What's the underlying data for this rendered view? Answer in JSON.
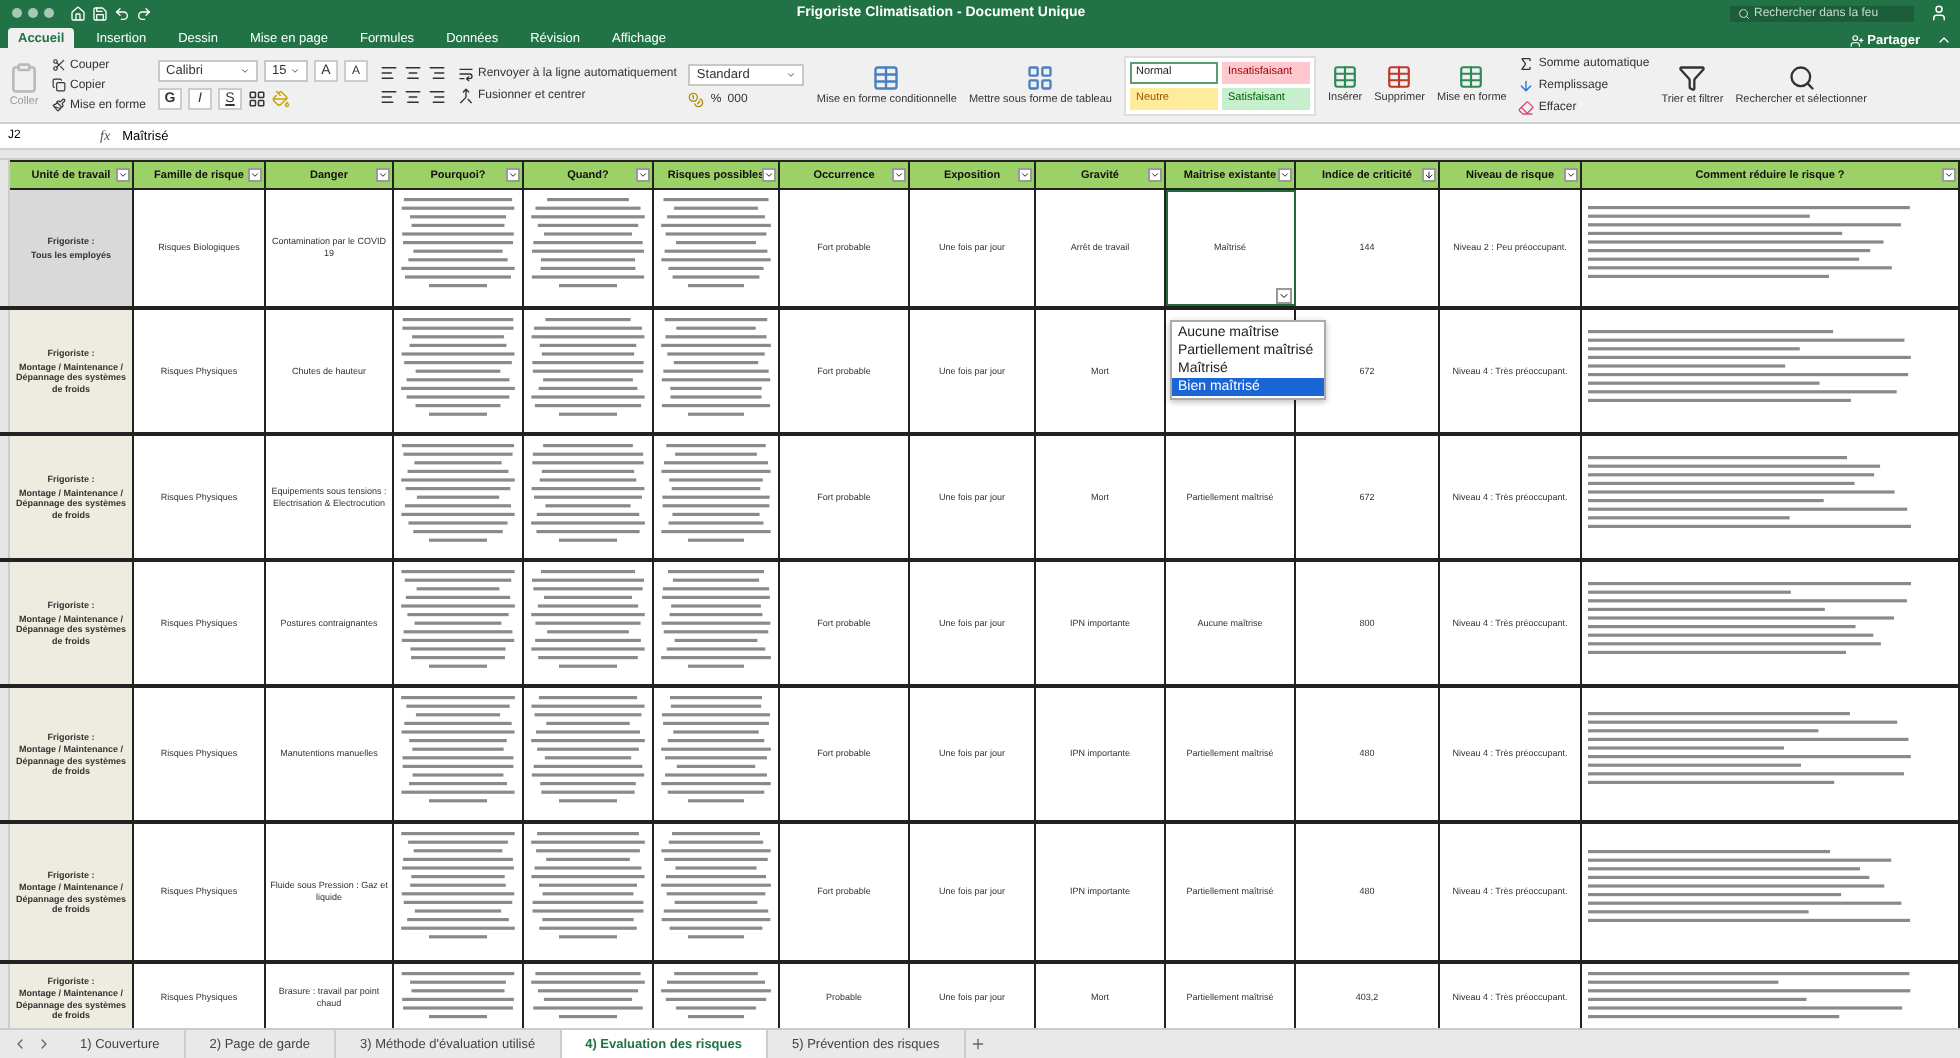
{
  "window": {
    "title": "Frigoriste Climatisation - Document Unique",
    "search_placeholder": "Rechercher dans la feu",
    "share": "Partager"
  },
  "ribbon_tabs": [
    {
      "label": "Accueil",
      "selected": true
    },
    {
      "label": "Insertion",
      "selected": false
    },
    {
      "label": "Dessin",
      "selected": false
    },
    {
      "label": "Mise en page",
      "selected": false
    },
    {
      "label": "Formules",
      "selected": false
    },
    {
      "label": "Données",
      "selected": false
    },
    {
      "label": "Révision",
      "selected": false
    },
    {
      "label": "Affichage",
      "selected": false
    }
  ],
  "ribbon": {
    "paste": "Coller",
    "cut": "Couper",
    "copy": "Copier",
    "format_painter": "Mise en forme",
    "font_name": "Calibri",
    "font_size": "15",
    "grow": "A",
    "shrink": "A",
    "bold": "G",
    "italic": "I",
    "underline": "S",
    "wrap": "Renvoyer à la ligne automatiquement",
    "merge": "Fusionner et centrer",
    "number_format": "Standard",
    "percent": "%",
    "thousands": "000",
    "conditional": "Mise en forme conditionnelle",
    "as_table": "Mettre sous forme de tableau",
    "styles": [
      {
        "label": "Normal",
        "kind": "normal"
      },
      {
        "label": "Insatisfaisant",
        "kind": "bad"
      },
      {
        "label": "Neutre",
        "kind": "neutral"
      },
      {
        "label": "Satisfaisant",
        "kind": "good"
      }
    ],
    "cells": [
      "Insérer",
      "Supprimer",
      "Mise en forme"
    ],
    "editing": [
      "Somme automatique",
      "Remplissage",
      "Effacer"
    ],
    "sort": "Trier et filtrer",
    "find": "Rechercher et sélectionner"
  },
  "formula_bar": {
    "cell": "J2",
    "fx": "fx",
    "value": "Maîtrisé"
  },
  "table": {
    "columns": [
      {
        "label": "Unité de travail",
        "sorted": false
      },
      {
        "label": "Famille de risque",
        "sorted": false
      },
      {
        "label": "Danger",
        "sorted": false
      },
      {
        "label": "Pourquoi?",
        "sorted": false
      },
      {
        "label": "Quand?",
        "sorted": false
      },
      {
        "label": "Risques possibles",
        "sorted": false
      },
      {
        "label": "Occurrence",
        "sorted": false
      },
      {
        "label": "Exposition",
        "sorted": false
      },
      {
        "label": "Gravité",
        "sorted": false
      },
      {
        "label": "Maitrise existante",
        "sorted": false
      },
      {
        "label": "Indice de criticité",
        "sorted": true
      },
      {
        "label": "Niveau de risque",
        "sorted": false
      },
      {
        "label": "Comment réduire le risque ?",
        "sorted": false
      }
    ],
    "rows": [
      {
        "unit_title": "Frigoriste :",
        "unit_detail": "Tous les employés",
        "shaded": true,
        "selected": true,
        "family": "Risques Biologiques",
        "danger": "Contamination par le COVID 19",
        "occurrence": "Fort probable",
        "exposure": "Une fois par jour",
        "severity": "Arrêt de travail",
        "control": "Maîtrisé",
        "criticality": "144",
        "level": "Niveau 2 : Peu préoccupant."
      },
      {
        "unit_title": "Frigoriste :",
        "unit_detail": "Montage / Maintenance / Dépannage des systèmes de froids",
        "shaded": false,
        "selected": false,
        "family": "Risques Physiques",
        "danger": "Chutes de hauteur",
        "occurrence": "Fort probable",
        "exposure": "Une fois par jour",
        "severity": "Mort",
        "criticality": "672",
        "level": "Niveau 4 : Très préoccupant."
      },
      {
        "unit_title": "Frigoriste :",
        "unit_detail": "Montage / Maintenance / Dépannage des systèmes de froids",
        "shaded": false,
        "selected": false,
        "family": "Risques Physiques",
        "danger": "Equipements sous tensions : Electrisation & Electrocution",
        "occurrence": "Fort probable",
        "exposure": "Une fois par jour",
        "severity": "Mort",
        "control": "Partiellement maîtrisé",
        "criticality": "672",
        "level": "Niveau 4 : Très préoccupant."
      },
      {
        "unit_title": "Frigoriste :",
        "unit_detail": "Montage / Maintenance / Dépannage des systèmes de froids",
        "shaded": false,
        "selected": false,
        "family": "Risques Physiques",
        "danger": "Postures contraignantes",
        "occurrence": "Fort probable",
        "exposure": "Une fois par jour",
        "severity": "IPN importante",
        "control": "Aucune maîtrise",
        "criticality": "800",
        "level": "Niveau 4 : Très préoccupant."
      },
      {
        "unit_title": "Frigoriste :",
        "unit_detail": "Montage / Maintenance / Dépannage des systèmes de froids",
        "shaded": false,
        "selected": false,
        "family": "Risques Physiques",
        "danger": "Manutentions manuelles",
        "occurrence": "Fort probable",
        "exposure": "Une fois par jour",
        "severity": "IPN importante",
        "control": "Partiellement maîtrisé",
        "criticality": "480",
        "level": "Niveau 4 : Très préoccupant."
      },
      {
        "unit_title": "Frigoriste :",
        "unit_detail": "Montage / Maintenance / Dépannage des systèmes de froids",
        "shaded": false,
        "selected": false,
        "family": "Risques Physiques",
        "danger": "Fluide sous Pression : Gaz et liquide",
        "occurrence": "Fort probable",
        "exposure": "Une fois par jour",
        "severity": "IPN importante",
        "control": "Partiellement maîtrisé",
        "criticality": "480",
        "level": "Niveau 4 : Très préoccupant."
      },
      {
        "unit_title": "Frigoriste :",
        "unit_detail": "Montage / Maintenance / Dépannage des systèmes de froids",
        "shaded": false,
        "selected": false,
        "family": "Risques Physiques",
        "danger": "Brasure : travail par point chaud",
        "occurrence": "Probable",
        "exposure": "Une fois par jour",
        "severity": "Mort",
        "control": "Partiellement maîtrisé",
        "criticality": "403,2",
        "level": "Niveau 4 : Très préoccupant."
      }
    ]
  },
  "dropdown": {
    "options": [
      {
        "label": "Aucune maîtrise",
        "selected": false
      },
      {
        "label": "Partiellement maîtrisé",
        "selected": false
      },
      {
        "label": "Maîtrisé",
        "selected": false
      },
      {
        "label": "Bien maîtrisé",
        "selected": true
      }
    ]
  },
  "sheet_tabs": [
    {
      "label": "1) Couverture",
      "selected": false
    },
    {
      "label": "2) Page de garde",
      "selected": false
    },
    {
      "label": "3) Méthode d'évaluation utilisé",
      "selected": false
    },
    {
      "label": "4) Evaluation des risques",
      "selected": true
    },
    {
      "label": "5) Prévention des risques",
      "selected": false
    }
  ]
}
